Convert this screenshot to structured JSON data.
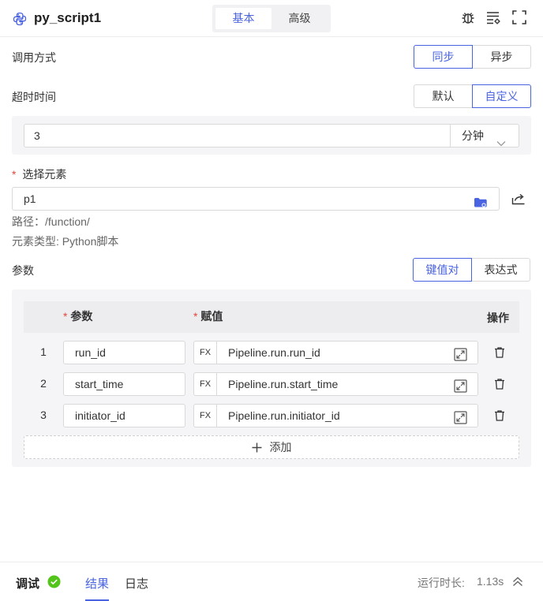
{
  "header": {
    "title": "py_script1",
    "tabs": [
      {
        "label": "基本"
      },
      {
        "label": "高级"
      }
    ],
    "active_tab": "基本",
    "icons": [
      "python-icon",
      "bug-icon",
      "list-settings-icon",
      "fullscreen-icon"
    ]
  },
  "call_mode": {
    "label": "调用方式",
    "options": [
      {
        "label": "同步"
      },
      {
        "label": "异步"
      }
    ],
    "selected": "同步"
  },
  "timeout": {
    "label": "超时时间",
    "options": [
      {
        "label": "默认"
      },
      {
        "label": "自定义"
      }
    ],
    "selected": "自定义",
    "value": "3",
    "unit": "分钟"
  },
  "element": {
    "required_mark": "*",
    "label": "选择元素",
    "value": "p1",
    "path_text": "路径：/function/",
    "type_text": "元素类型: Python脚本"
  },
  "params": {
    "label": "参数",
    "modes": [
      {
        "label": "键值对"
      },
      {
        "label": "表达式"
      }
    ],
    "selected": "键值对",
    "columns": {
      "param": "参数",
      "value": "赋值",
      "action": "操作"
    },
    "fx_label": "FX",
    "rows": [
      {
        "index": "1",
        "name": "run_id",
        "value": "Pipeline.run.run_id"
      },
      {
        "index": "2",
        "name": "start_time",
        "value": "Pipeline.run.start_time"
      },
      {
        "index": "3",
        "name": "initiator_id",
        "value": "Pipeline.run.initiator_id"
      }
    ],
    "add_label": "添加"
  },
  "footer": {
    "debug_label": "调试",
    "tabs": [
      {
        "label": "结果"
      },
      {
        "label": "日志"
      }
    ],
    "active_tab": "结果",
    "runtime_label": "运行时长:",
    "runtime_value": "1.13s"
  },
  "colors": {
    "accent": "#4a63e0",
    "success": "#52c41a",
    "required": "#e2453a"
  }
}
